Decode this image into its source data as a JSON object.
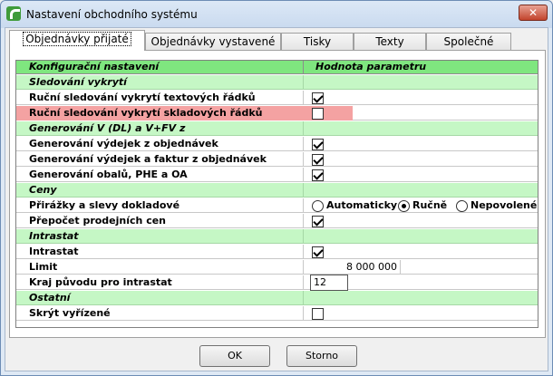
{
  "window": {
    "title": "Nastavení obchodního systému",
    "close_label": "✕"
  },
  "tabs": [
    {
      "label": "Objednávky přijaté",
      "active": true
    },
    {
      "label": "Objednávky vystavené",
      "active": false
    },
    {
      "label": "Tisky",
      "active": false
    },
    {
      "label": "Texty",
      "active": false
    },
    {
      "label": "Společné",
      "active": false
    }
  ],
  "grid": {
    "col1_header": "Konfigurační nastavení",
    "col2_header": "Hodnota parametru",
    "sections": [
      {
        "title": "Sledování vykrytí",
        "rows": [
          {
            "label": "Ruční sledování vykrytí textových řádků",
            "type": "checkbox",
            "checked": true
          },
          {
            "label": "Ruční sledování vykrytí skladových řádků",
            "type": "checkbox",
            "checked": false,
            "selected": true
          }
        ]
      },
      {
        "title": "Generování V (DL) a V+FV z",
        "rows": [
          {
            "label": "Generování výdejek z objednávek",
            "type": "checkbox",
            "checked": true
          },
          {
            "label": "Generování výdejek a faktur z objednávek",
            "type": "checkbox",
            "checked": true
          },
          {
            "label": "Generování obalů, PHE a OA",
            "type": "checkbox",
            "checked": true
          }
        ]
      },
      {
        "title": "Ceny",
        "rows": [
          {
            "label": "Přirážky a slevy dokladové",
            "type": "radio",
            "options": [
              "Automaticky",
              "Ručně",
              "Nepovolené"
            ],
            "selected_option": "Ručně"
          },
          {
            "label": "Přepočet prodejních cen",
            "type": "checkbox",
            "checked": true
          }
        ]
      },
      {
        "title": "Intrastat",
        "rows": [
          {
            "label": "Intrastat",
            "type": "checkbox",
            "checked": true
          },
          {
            "label": "Limit",
            "type": "number",
            "value": "8 000 000"
          },
          {
            "label": "Kraj původu pro intrastat",
            "type": "input",
            "value": "12"
          }
        ]
      },
      {
        "title": "Ostatní",
        "rows": [
          {
            "label": "Skrýt vyřízené",
            "type": "checkbox",
            "checked": false
          }
        ]
      }
    ]
  },
  "buttons": {
    "ok_label": "OK",
    "cancel_label": "Storno"
  }
}
